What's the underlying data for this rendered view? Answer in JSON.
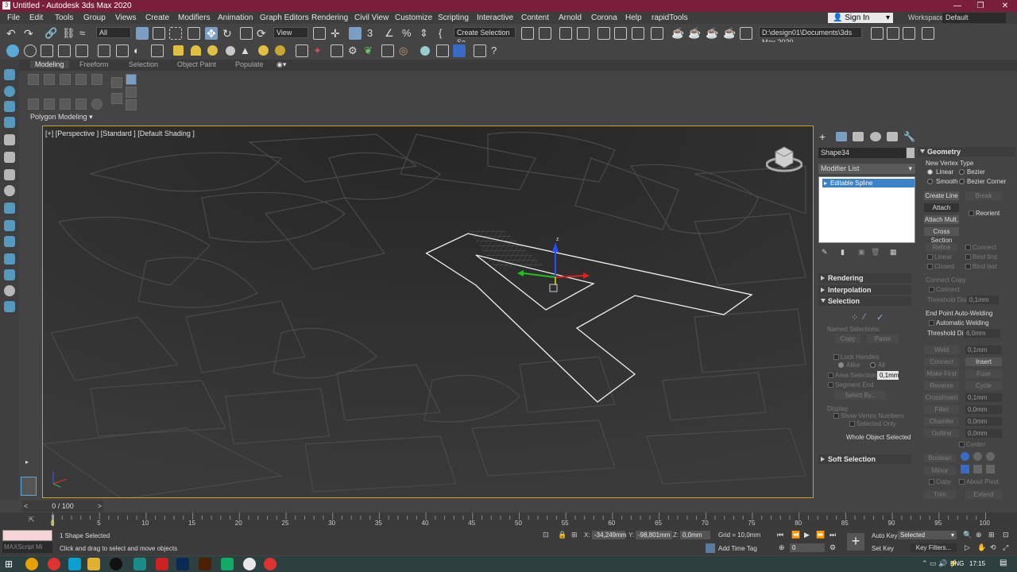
{
  "window": {
    "title": "Untitled - Autodesk 3ds Max 2020",
    "app_icon": "3"
  },
  "menu": [
    "File",
    "Edit",
    "Tools",
    "Group",
    "Views",
    "Create",
    "Modifiers",
    "Animation",
    "Graph Editors",
    "Rendering",
    "Civil View",
    "Customize",
    "Scripting",
    "Interactive",
    "Content",
    "Arnold",
    "Corona",
    "Help",
    "rapidTools"
  ],
  "account": {
    "sign_in": "Sign In",
    "workspaces_label": "Workspaces:",
    "workspace": "Default"
  },
  "toolbar": {
    "filter": "All",
    "ref_coord": "View",
    "selection_set": "Create Selection Se",
    "project_path": "D:\\design01\\Documents\\3ds Max 2020"
  },
  "ribbon": {
    "tabs": [
      "Modeling",
      "Freeform",
      "Selection",
      "Object Paint",
      "Populate"
    ],
    "panel": "Polygon Modeling"
  },
  "viewport": {
    "label": "[+] [Perspective ] [Standard ] [Default Shading ]"
  },
  "command_panel": {
    "object_name": "Shape34",
    "modifier_list": "Modifier List",
    "stack_item": "Editable Spline",
    "rollouts": {
      "rendering": "Rendering",
      "interpolation": "Interpolation",
      "selection": "Selection",
      "soft_selection": "Soft Selection"
    },
    "selection": {
      "named_selections": "Named Selections:",
      "copy": "Copy",
      "paste": "Paste",
      "lock_handles": "Lock Handles",
      "alike": "Alike",
      "all": "All",
      "area_selection": "Area Selection:",
      "area_value": "0,1mm",
      "segment_end": "Segment End",
      "select_by": "Select By...",
      "display": "Display",
      "show_vertex_numbers": "Show Vertex Numbers",
      "selected_only": "Selected Only",
      "status": "Whole Object Selected"
    },
    "geometry": {
      "title": "Geometry",
      "new_vertex_type": "New Vertex Type",
      "linear": "Linear",
      "bezier": "Bezier",
      "smooth": "Smooth",
      "bezier_corner": "Bezier Corner",
      "create_line": "Create Line",
      "break": "Break",
      "attach": "Attach",
      "reorient": "Reorient",
      "attach_mult": "Attach Mult.",
      "cross_section": "Cross Section",
      "refine": "Refine",
      "connect": "Connect",
      "linear2": "Linear",
      "bind_first": "Bind first",
      "closed": "Closed",
      "bind_last": "Bind last",
      "connect_copy": "Connect Copy",
      "connect2": "Connect",
      "threshold_dist": "Threshold Dist",
      "threshold_val1": "0,1mm",
      "end_point_welding": "End Point Auto-Welding",
      "automatic_welding": "Automatic Welding",
      "threshold_val2": "6,0mm",
      "weld": "Weld",
      "weld_val": "0,1mm",
      "connect3": "Connect",
      "insert": "Insert",
      "make_first": "Make First",
      "fuse": "Fuse",
      "reverse": "Reverse",
      "cycle": "Cycle",
      "crossinsert": "CrossInsert",
      "crossinsert_val": "0,1mm",
      "fillet": "Fillet",
      "fillet_val": "0,0mm",
      "chamfer": "Chamfer",
      "chamfer_val": "0,0mm",
      "outline": "Outline",
      "outline_val": "0,0mm",
      "center": "Center",
      "boolean": "Boolean",
      "mirror": "Mirror",
      "copy": "Copy",
      "about_pivot": "About Pivot",
      "trim": "Trim",
      "extend": "Extend"
    }
  },
  "timeline": {
    "frame": "0 / 100",
    "ticks": [
      "0",
      "5",
      "10",
      "15",
      "20",
      "25",
      "30",
      "35",
      "40",
      "45",
      "50",
      "55",
      "60",
      "65",
      "70",
      "75",
      "80",
      "85",
      "90",
      "95",
      "100"
    ]
  },
  "status": {
    "maxscript": "MAXScript Mi",
    "selected": "1 Shape Selected",
    "prompt": "Click and drag to select and move objects",
    "x_label": "X:",
    "x": "-34,249mm",
    "y_label": "Y:",
    "y": "-98,801mm",
    "z_label": "Z:",
    "z": "0,0mm",
    "grid": "Grid = 10,0mm",
    "add_time_tag": "Add Time Tag",
    "auto_key": "Auto Key",
    "set_key": "Set Key",
    "selected_drop": "Selected",
    "key_filters": "Key Filters...",
    "frame_field": "0"
  },
  "taskbar": {
    "lang": "ENG",
    "time": "17:15"
  },
  "colors": {
    "title_bg": "#7a1f3a",
    "viewport_border": "#d4a017",
    "stack_highlight": "#3b82c6"
  }
}
